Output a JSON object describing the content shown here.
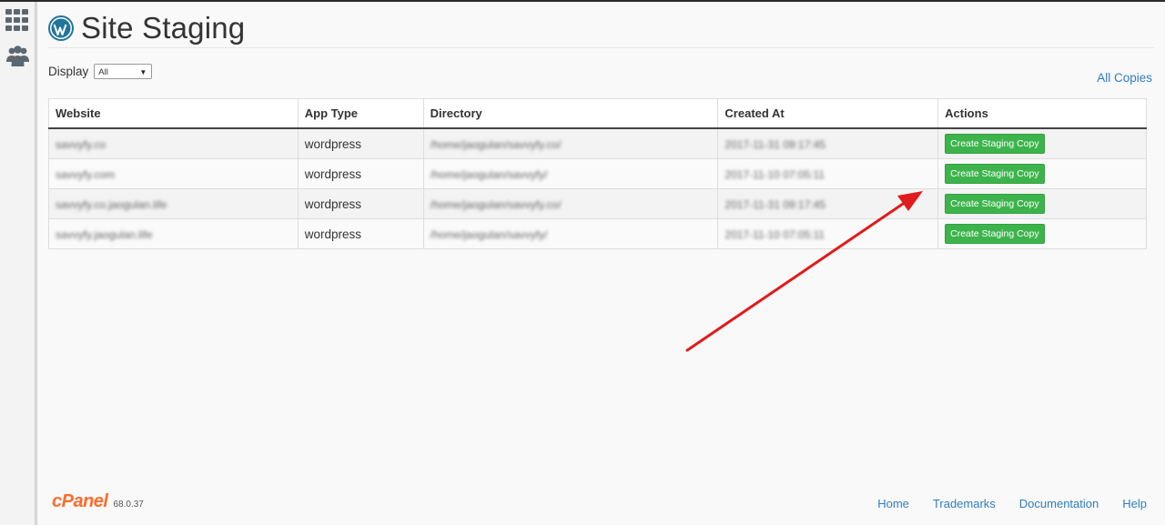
{
  "page": {
    "title": "Site Staging"
  },
  "filter": {
    "label": "Display",
    "selected": "All"
  },
  "links": {
    "all_copies": "All Copies"
  },
  "table": {
    "headers": [
      "Website",
      "App Type",
      "Directory",
      "Created At",
      "Actions"
    ],
    "rows": [
      {
        "website": "savvyfy.co",
        "app_type": "wordpress",
        "directory": "/home/jaogulan/savvyfy.co/",
        "created_at": "2017-11-31 09:17:45",
        "action": "Create Staging Copy"
      },
      {
        "website": "savvyfy.com",
        "app_type": "wordpress",
        "directory": "/home/jaogulan/savvyfy/",
        "created_at": "2017-11-10 07:05:11",
        "action": "Create Staging Copy"
      },
      {
        "website": "savvyfy.co.jaogulan.life",
        "app_type": "wordpress",
        "directory": "/home/jaogulan/savvyfy.co/",
        "created_at": "2017-11-31 09:17:45",
        "action": "Create Staging Copy"
      },
      {
        "website": "savvyfy.jaogulan.life",
        "app_type": "wordpress",
        "directory": "/home/jaogulan/savvyfy/",
        "created_at": "2017-11-10 07:05:11",
        "action": "Create Staging Copy"
      }
    ]
  },
  "footer": {
    "brand": "cPanel",
    "version": "68.0.37",
    "links": [
      "Home",
      "Trademarks",
      "Documentation",
      "Help"
    ]
  },
  "icons": {
    "sidebar": [
      "apps-grid-icon",
      "users-icon"
    ],
    "title": "wordpress-logo-icon"
  },
  "colors": {
    "button_green": "#3cb44b",
    "link_blue": "#2f7dc1",
    "cpanel_orange": "#ff6c2c",
    "annotation_arrow": "#e01b1b"
  }
}
